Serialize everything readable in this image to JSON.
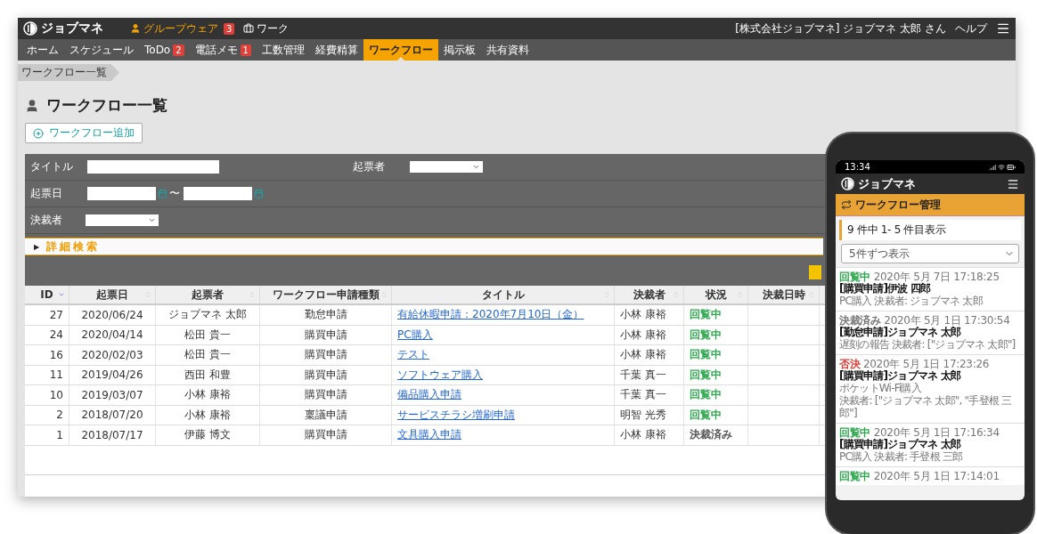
{
  "app": {
    "logo": "ジョブマネ",
    "modules": [
      {
        "label": "グループウェア",
        "badge": "3",
        "selected": true
      },
      {
        "label": "ワーク",
        "selected": false
      }
    ],
    "user": "[株式会社ジョブマネ] ジョブマネ 太郎 さん",
    "help": "ヘルプ"
  },
  "nav": [
    {
      "label": "ホーム",
      "selected": false
    },
    {
      "label": "スケジュール",
      "selected": false
    },
    {
      "label": "ToDo",
      "badge": "2",
      "selected": false
    },
    {
      "label": "電話メモ",
      "badge": "1",
      "selected": false
    },
    {
      "label": "工数管理",
      "selected": false
    },
    {
      "label": "経費精算",
      "selected": false
    },
    {
      "label": "ワークフロー",
      "selected": true
    },
    {
      "label": "掲示板",
      "selected": false
    },
    {
      "label": "共有資料",
      "selected": false
    }
  ],
  "breadcrumb": "ワークフロー一覧",
  "page_title": "ワークフロー一覧",
  "add_button": "ワークフロー追加",
  "search": {
    "title_label": "タイトル",
    "issuer_label": "起票者",
    "date_label": "起票日",
    "range_separator": "〜",
    "approver_label": "決裁者",
    "advanced_arrow": "▶",
    "advanced_label": "詳細検索"
  },
  "table": {
    "columns": [
      {
        "label": "ID",
        "sorted": true
      },
      {
        "label": "起票日",
        "sorted": false
      },
      {
        "label": "起票者",
        "sorted": false
      },
      {
        "label": "ワークフロー申請種類",
        "sorted": false
      },
      {
        "label": "タイトル",
        "sorted": false
      },
      {
        "label": "決裁者",
        "sorted": false
      },
      {
        "label": "状況",
        "sorted": false
      },
      {
        "label": "決裁日時",
        "sorted": false
      }
    ],
    "rows": [
      {
        "id": "27",
        "date": "2020/06/24",
        "issuer": "ジョブマネ 太郎",
        "type": "勤怠申請",
        "title": "有給休暇申請：2020年7月10日（金）",
        "approver": "小林 康裕",
        "status": "回覧中",
        "color": "#2fa84f"
      },
      {
        "id": "24",
        "date": "2020/04/14",
        "issuer": "松田 貴一",
        "type": "購買申請",
        "title": "PC購入",
        "approver": "小林 康裕",
        "status": "回覧中",
        "color": "#2fa84f"
      },
      {
        "id": "16",
        "date": "2020/02/03",
        "issuer": "松田 貴一",
        "type": "購買申請",
        "title": "テスト",
        "approver": "小林 康裕",
        "status": "回覧中",
        "color": "#2fa84f"
      },
      {
        "id": "11",
        "date": "2019/04/26",
        "issuer": "西田 和豊",
        "type": "購買申請",
        "title": "ソフトウェア購入",
        "approver": "千葉 真一",
        "status": "回覧中",
        "color": "#2fa84f"
      },
      {
        "id": "10",
        "date": "2019/03/07",
        "issuer": "小林 康裕",
        "type": "購買申請",
        "title": "備品購入申請",
        "approver": "千葉 真一",
        "status": "回覧中",
        "color": "#2fa84f"
      },
      {
        "id": "2",
        "date": "2018/07/20",
        "issuer": "小林 康裕",
        "type": "稟議申請",
        "title": "サービスチラシ増刷申請",
        "approver": "明智 光秀",
        "status": "回覧中",
        "color": "#2fa84f"
      },
      {
        "id": "1",
        "date": "2018/07/17",
        "issuer": "伊藤 博文",
        "type": "購買申請",
        "title": "文具購入申請",
        "approver": "小林 康裕",
        "status": "決裁済み",
        "color": "#555555"
      }
    ]
  },
  "phone": {
    "time": "13:34",
    "logo": "ジョブマネ",
    "section": "ワークフロー管理",
    "count": "9 件中 1- 5 件目表示",
    "page_size": "5件ずつ表示",
    "items": [
      {
        "status": "回覧中",
        "color": "#2fa84f",
        "date": "2020年 5月 7日 17:18:25",
        "title": "[購買申請]伊波 四郎",
        "lines": [
          "PC購入 決裁者: ジョブマネ 太郎"
        ]
      },
      {
        "status": "決裁済み",
        "color": "#777777",
        "date": "2020年 5月 1日 17:30:54",
        "title": "[勤怠申請]ジョブマネ 太郎",
        "lines": [
          "遅刻の報告 決裁者: [\"ジョブマネ 太郎\"]"
        ]
      },
      {
        "status": "否決",
        "color": "#d9413a",
        "date": "2020年 5月 1日 17:23:26",
        "title": "[購買申請]ジョブマネ 太郎",
        "lines": [
          "ポケットWi-Fi購入",
          "決裁者: [\"ジョブマネ 太郎\", \"手登根 三郎\"]"
        ]
      },
      {
        "status": "回覧中",
        "color": "#2fa84f",
        "date": "2020年 5月 1日 17:16:34",
        "title": "[購買申請]ジョブマネ 太郎",
        "lines": [
          "PC購入 決裁者: 手登根 三郎"
        ]
      },
      {
        "status": "回覧中",
        "color": "#2fa84f",
        "date": "2020年 5月 1日 17:14:01"
      }
    ]
  }
}
